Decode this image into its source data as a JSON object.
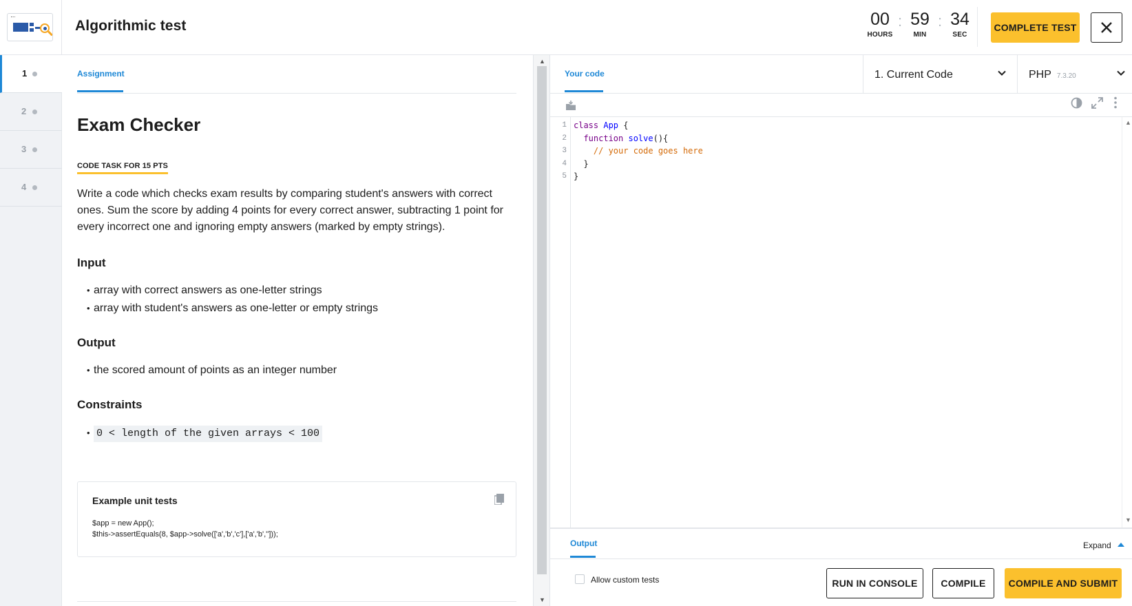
{
  "header": {
    "title": "Algorithmic test",
    "timer": {
      "hours": "00",
      "hours_label": "HOURS",
      "minutes": "59",
      "minutes_label": "MIN",
      "seconds": "34",
      "seconds_label": "SEC"
    },
    "complete_label": "COMPLETE TEST",
    "close_icon": "close-icon"
  },
  "questions": [
    {
      "number": "1",
      "active": true
    },
    {
      "number": "2",
      "active": false
    },
    {
      "number": "3",
      "active": false
    },
    {
      "number": "4",
      "active": false
    }
  ],
  "assignment": {
    "tab_label": "Assignment",
    "title": "Exam Checker",
    "tag": "CODE TASK FOR 15 PTS",
    "description": "Write a code which checks exam results by comparing student's answers with correct ones. Sum the score by adding 4 points for every correct answer, subtracting 1 point for every incorrect one and ignoring empty answers (marked by empty strings).",
    "input_heading": "Input",
    "input_items": [
      "array with correct answers as one-letter strings",
      "array with student's answers as one-letter or empty strings"
    ],
    "output_heading": "Output",
    "output_items": [
      "the scored amount of points as an integer number"
    ],
    "constraints_heading": "Constraints",
    "constraints_items": [
      "0 < length of the given arrays < 100"
    ],
    "example": {
      "title": "Example unit tests",
      "lines": [
        "$app = new App();",
        "$this->assertEquals(8, $app->solve(['a','b','c'],['a','b','']));"
      ]
    }
  },
  "editor": {
    "tab_label": "Your code",
    "code_version": "1. Current Code",
    "language": "PHP",
    "language_version": "7.3.20",
    "line_numbers": [
      "1",
      "2",
      "3",
      "4",
      "5"
    ],
    "code_lines": [
      {
        "kw": "class",
        "sp": " ",
        "df": "App",
        "rest": " {",
        "cm": ""
      },
      {
        "kw": "  function",
        "sp": " ",
        "df": "solve",
        "rest": "(){",
        "cm": ""
      },
      {
        "kw": "",
        "sp": "",
        "df": "",
        "rest": "",
        "cm": "    // your code goes here"
      },
      {
        "kw": "",
        "sp": "",
        "df": "",
        "rest": "  }",
        "cm": ""
      },
      {
        "kw": "",
        "sp": "",
        "df": "",
        "rest": "}",
        "cm": ""
      }
    ]
  },
  "output": {
    "tab_label": "Output",
    "expand_label": "Expand",
    "allow_custom_tests_label": "Allow custom tests",
    "allow_custom_tests_checked": false,
    "run_label": "RUN IN CONSOLE",
    "compile_label": "COMPILE",
    "submit_label": "COMPILE AND SUBMIT"
  },
  "colors": {
    "accent": "#1e88d6",
    "primary_button": "#fbc02d",
    "nav_bg": "#f0f2f5"
  }
}
